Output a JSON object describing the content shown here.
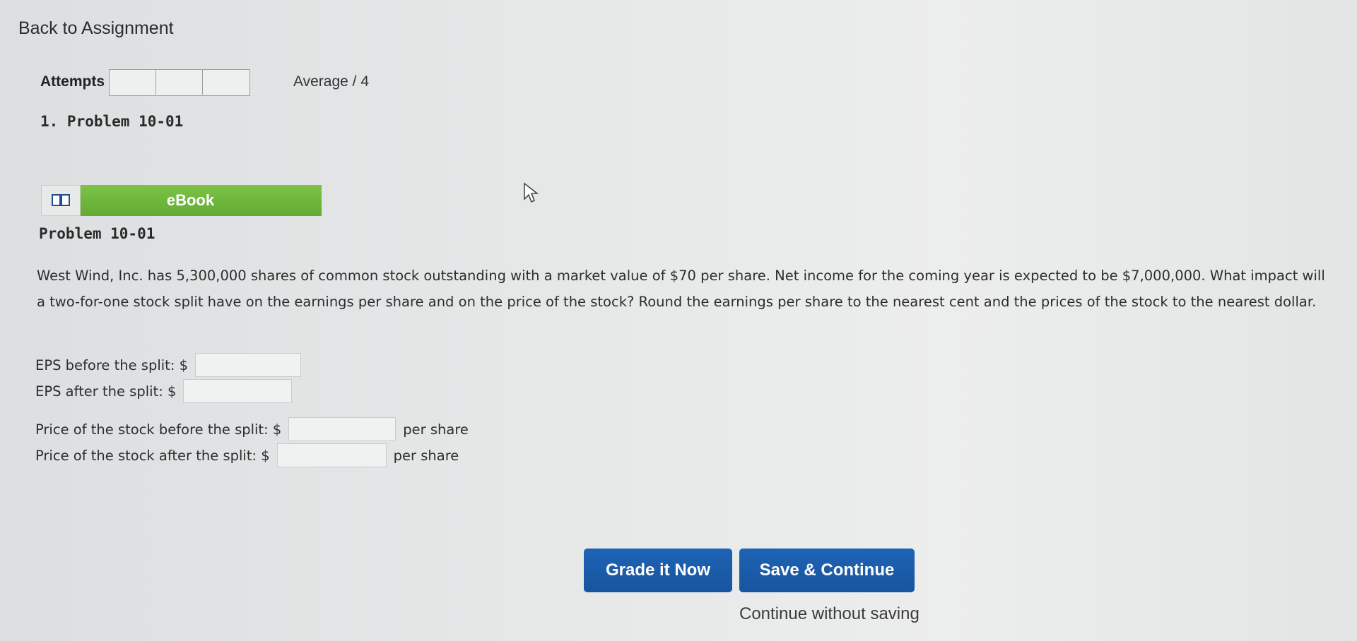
{
  "nav": {
    "back_label": "Back to Assignment"
  },
  "attempts": {
    "label": "Attempts",
    "average_label": "Average / 4"
  },
  "problem": {
    "heading": "1. Problem 10-01",
    "ebook_label": "eBook",
    "title": "Problem 10-01",
    "text": "West Wind, Inc. has 5,300,000 shares of common stock outstanding with a market value of $70 per share. Net income for the coming year is expected to be $7,000,000. What impact will a two-for-one stock split have on the earnings per share and on the price of the stock? Round the earnings per share to the nearest cent and the prices of the stock to the nearest dollar."
  },
  "fields": [
    {
      "label": "EPS before the split: $",
      "value": "",
      "unit": ""
    },
    {
      "label": "EPS after the split: $",
      "value": "",
      "unit": ""
    },
    {
      "label": "Price of the stock before the split: $",
      "value": "",
      "unit": "per share"
    },
    {
      "label": "Price of the stock after the split: $",
      "value": "",
      "unit": "per share"
    }
  ],
  "actions": {
    "grade_label": "Grade it Now",
    "save_label": "Save & Continue",
    "continue_label": "Continue without saving"
  },
  "colors": {
    "ebook_green": "#6fb73c",
    "button_blue": "#1a5aa8"
  }
}
